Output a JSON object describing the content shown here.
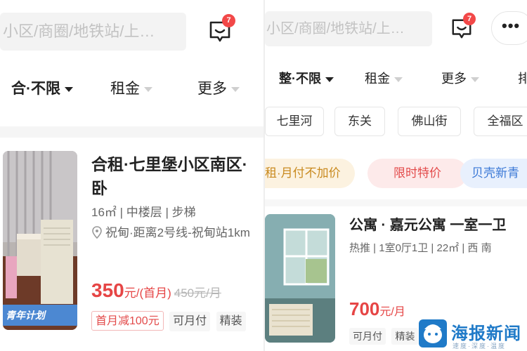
{
  "left": {
    "search": {
      "placeholder": "小区/商圈/地铁站/上…"
    },
    "message_badge": "7",
    "filters": [
      {
        "label": "合·不限",
        "active": true
      },
      {
        "label": "租金",
        "active": false
      },
      {
        "label": "更多",
        "active": false
      }
    ],
    "listing": {
      "title": "合租·七里堡小区南区·卧",
      "meta": "16㎡ | 中楼层 | 步梯",
      "location": "祝甸·距离2号线-祝甸站1km",
      "price": "350",
      "price_unit": "元/(首月)",
      "old_price": "450元/月",
      "ribbon": "青年计划",
      "tags": [
        "首月减100元",
        "可月付",
        "精装"
      ]
    }
  },
  "right": {
    "search": {
      "placeholder": "小区/商圈/地铁站/上…"
    },
    "message_badge": "7",
    "more_button": "•••",
    "filters": [
      {
        "label": "整·不限",
        "active": true
      },
      {
        "label": "租金",
        "active": false
      },
      {
        "label": "更多",
        "active": false
      },
      {
        "label": "排",
        "active": false
      }
    ],
    "district_chips": [
      "七里河",
      "东关",
      "佛山街",
      "全福区"
    ],
    "promos": [
      "租·月付不加价",
      "限时特价",
      "贝壳新青"
    ],
    "listing": {
      "title": "公寓 · 嘉元公寓 一室一卫",
      "meta": "热推 | 1室0厅1卫 | 22㎡ | 西 南",
      "price": "700",
      "price_unit": "元/月",
      "tags": [
        "可月付",
        "精装"
      ]
    }
  },
  "watermark": {
    "name": "海报新闻",
    "subtitle": "速度·深度·温度"
  },
  "colors": {
    "accent_red": "#e64545",
    "badge_red": "#f24848",
    "promo_blue": "#3a78d6",
    "promo_gold": "#c98a1f"
  }
}
